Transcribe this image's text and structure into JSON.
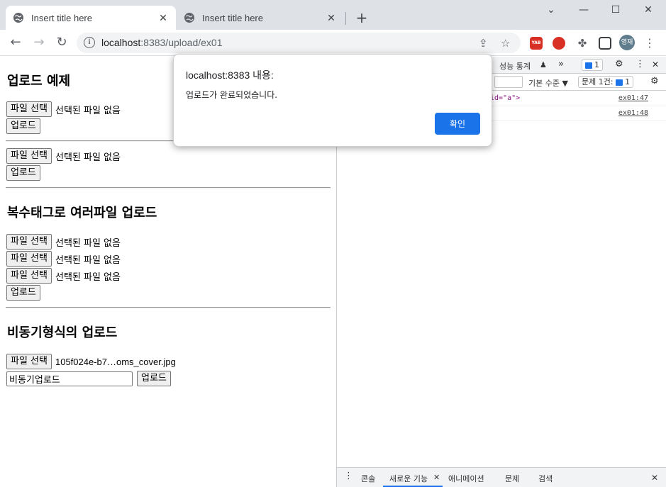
{
  "browser": {
    "tabs": [
      {
        "title": "Insert title here",
        "close": "✕"
      },
      {
        "title": "Insert title here",
        "close": "✕"
      }
    ],
    "new_tab": "+",
    "window_controls": {
      "dropdown": "⌄",
      "minimize": "—",
      "maximize": "☐",
      "close": "✕"
    },
    "url_host": "localhost",
    "url_rest": ":8383/upload/ex01",
    "avatar_label": "영재",
    "extension_label": "YAB"
  },
  "page": {
    "section1_title": "업로드 예제",
    "file_button": "파일 선택",
    "no_file": "선택된 파일 없음",
    "upload_button": "업로드",
    "section2_title": "복수태그로 여러파일 업로드",
    "section3_title": "비동기형식의 업로드",
    "selected_file": "105f024e-b7…oms_cover.jpg",
    "async_input_value": "비동기업로드"
  },
  "devtools": {
    "top_tab": "성능 통계",
    "more": "»",
    "msg_count": "1",
    "level_label": "기본 수준 ▼",
    "issues_label": "문제 1건:",
    "issues_count": "1",
    "log_fragment": "id=\"a\">",
    "log_links": [
      "ex01:47",
      "ex01:48"
    ],
    "bottom_tabs": [
      "콘솔",
      "새로운 기능",
      "애니메이션",
      "문제",
      "검색"
    ],
    "close": "✕"
  },
  "dialog": {
    "title": "localhost:8383 내용:",
    "message": "업로드가 완료되었습니다.",
    "ok_label": "확인"
  },
  "colors": {
    "accent": "#1a73e8",
    "tabbar": "#dee1e6"
  }
}
